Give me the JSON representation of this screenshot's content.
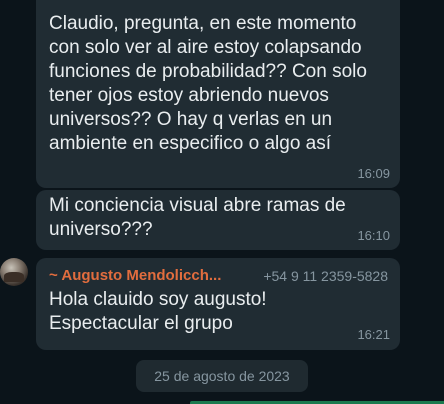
{
  "messages": [
    {
      "text": "Claudio, pregunta, en este momento\ncon solo ver al aire estoy colapsando\nfunciones de probabilidad?? Con solo\ntener ojos estoy abriendo nuevos\nuniversos?? O hay q verlas en un\nambiente en especifico o algo así",
      "time": "16:09"
    },
    {
      "text": "Mi conciencia visual abre ramas de\nuniverso???",
      "time": "16:10"
    },
    {
      "sender_name": "~ Augusto Mendolicch...",
      "sender_phone": "+54 9 11 2359-5828",
      "text": "Hola clauido soy augusto!\nEspectacular el grupo",
      "time": "16:21"
    }
  ],
  "date_divider": "25 de agosto de 2023",
  "colors": {
    "background": "#0b141a",
    "bubble": "#202c33",
    "sender_name": "#e26d3e",
    "meta_text": "#8696a0"
  },
  "icons": {
    "avatar": "user-avatar-photo"
  }
}
